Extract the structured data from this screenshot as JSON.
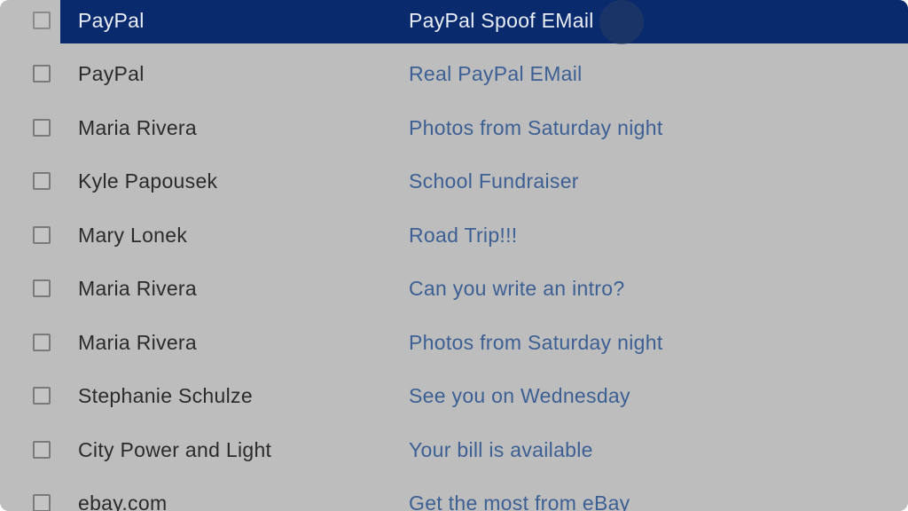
{
  "emails": [
    {
      "sender": "PayPal",
      "subject": "PayPal Spoof EMail",
      "selected": true
    },
    {
      "sender": "PayPal",
      "subject": "Real PayPal EMail",
      "selected": false
    },
    {
      "sender": "Maria Rivera",
      "subject": "Photos from Saturday night",
      "selected": false
    },
    {
      "sender": "Kyle Papousek",
      "subject": "School Fundraiser",
      "selected": false
    },
    {
      "sender": "Mary Lonek",
      "subject": "Road Trip!!!",
      "selected": false
    },
    {
      "sender": "Maria Rivera",
      "subject": "Can you write an intro?",
      "selected": false
    },
    {
      "sender": "Maria Rivera",
      "subject": "Photos from Saturday night",
      "selected": false
    },
    {
      "sender": "Stephanie Schulze",
      "subject": "See you on Wednesday",
      "selected": false
    },
    {
      "sender": "City Power and Light",
      "subject": "Your bill is available",
      "selected": false
    },
    {
      "sender": "ebay.com",
      "subject": "Get the most from eBay",
      "selected": false
    }
  ],
  "colors": {
    "selected_row": "#0a2a6e",
    "subject_link": "#3c5f94",
    "background": "#bdbdbd"
  }
}
